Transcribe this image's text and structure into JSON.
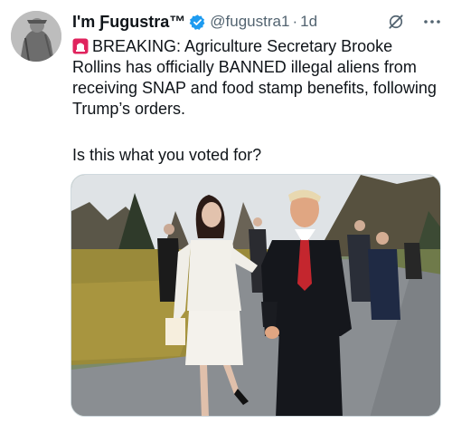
{
  "author": {
    "display_name": "I'm Ƒugustra™",
    "handle": "@fugustra1",
    "separator": "·",
    "time": "1d",
    "avatar_icon": "profile-avatar"
  },
  "tweet": {
    "line1": "BREAKING: Agriculture Secretary Brooke Rollins has officially BANNED illegal aliens from receiving SNAP and food stamp benefits, following Trump’s orders.",
    "question": "Is this what you voted for?"
  },
  "icons": {
    "verified": "verified-badge-icon",
    "grok": "grok-icon",
    "more": "more-options-icon",
    "siren": "siren-emoji-icon"
  },
  "colors": {
    "verified_blue": "#1d9bf0",
    "text_primary": "#0f1419",
    "text_secondary": "#536471",
    "siren_red": "#e0245e"
  }
}
